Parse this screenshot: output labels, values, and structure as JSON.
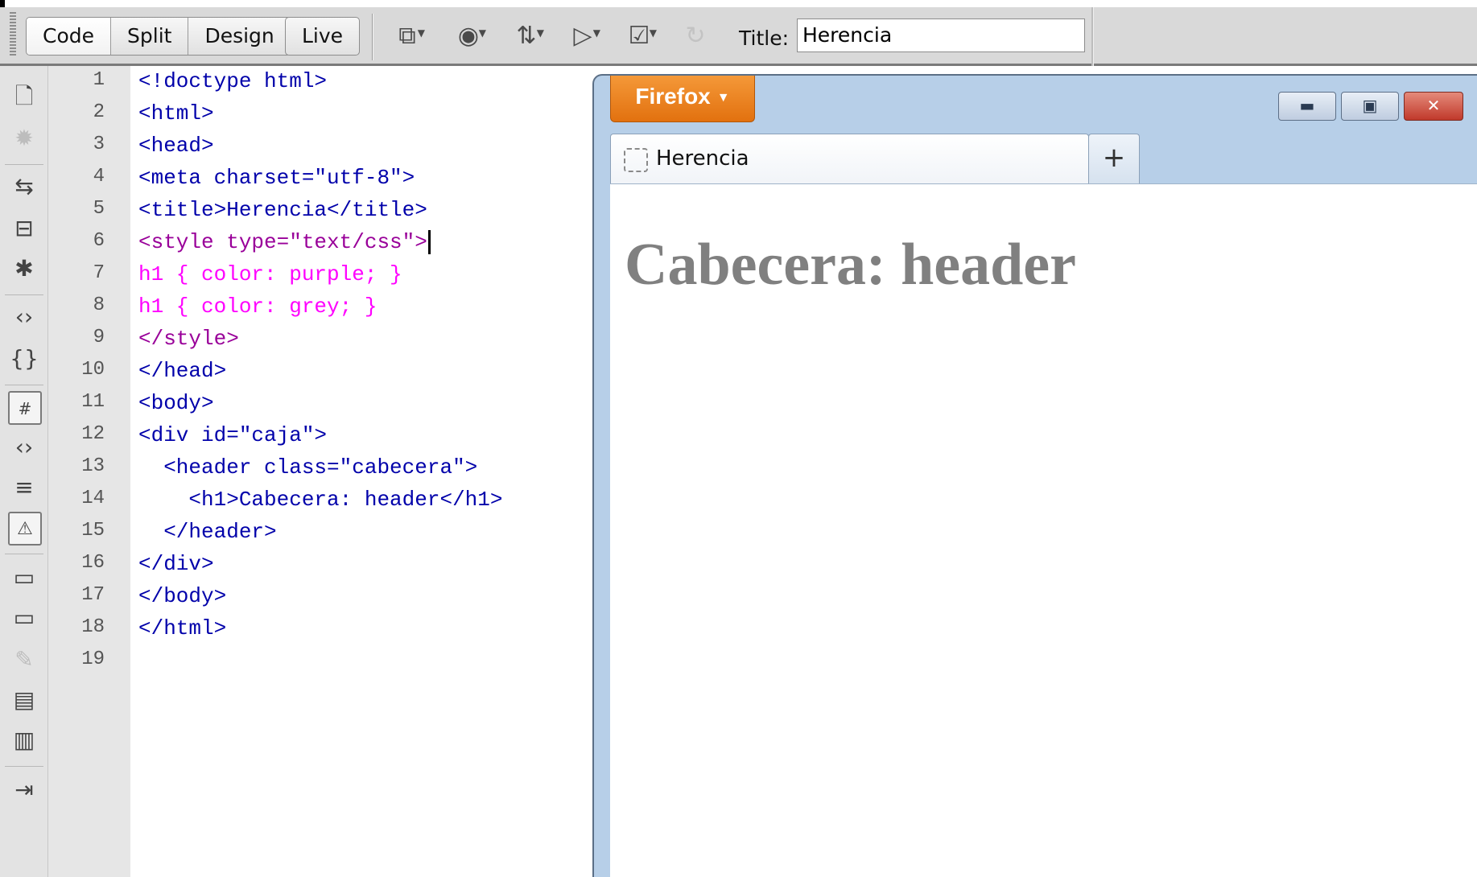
{
  "toolbar": {
    "views": [
      "Code",
      "Split",
      "Design",
      "Live"
    ],
    "icons": [
      "multiscreen-icon",
      "preview-globe-icon",
      "file-transfer-icon",
      "debug-icon",
      "validate-icon",
      "refresh-icon"
    ],
    "title_label": "Title:",
    "title_value": "Herencia"
  },
  "sidebar": {
    "icons": [
      "open-documents-icon",
      "show-code-navigator-icon",
      "collapse-full-tag-icon",
      "collapse-selection-icon",
      "expand-all-icon",
      "select-parent-tag-icon",
      "balance-braces-icon",
      "line-numbers-icon",
      "highlight-invalid-code-icon",
      "syntax-coloring-icon",
      "word-wrap-icon",
      "syntax-error-alerts-icon",
      "apply-comment-icon",
      "remove-comment-icon",
      "wrap-tag-icon",
      "recent-snippets-icon",
      "move-css-icon",
      "indent-code-icon"
    ]
  },
  "editor": {
    "line_numbers": [
      "1",
      "2",
      "3",
      "4",
      "5",
      "6",
      "7",
      "8",
      "9",
      "10",
      "11",
      "12",
      "13",
      "14",
      "15",
      "16",
      "17",
      "18",
      "19"
    ],
    "lines": [
      "<!doctype html>",
      "<html>",
      "<head>",
      "<meta charset=\"utf-8\">",
      "<title>Herencia</title>",
      "<style type=\"text/css\">",
      "h1 { color: purple; }",
      "h1 { color: grey; }",
      "</style>",
      "</head>",
      "<body>",
      "<div id=\"caja\">",
      "  <header class=\"cabecera\">",
      "    <h1>Cabecera: header</h1>",
      "  </header>",
      "</div>",
      "</body>",
      "</html>"
    ]
  },
  "browser": {
    "menu_button": "Firefox",
    "tab_title": "Herencia",
    "new_tab": "+",
    "page_heading": "Cabecera: header",
    "heading_color": "#808080"
  }
}
